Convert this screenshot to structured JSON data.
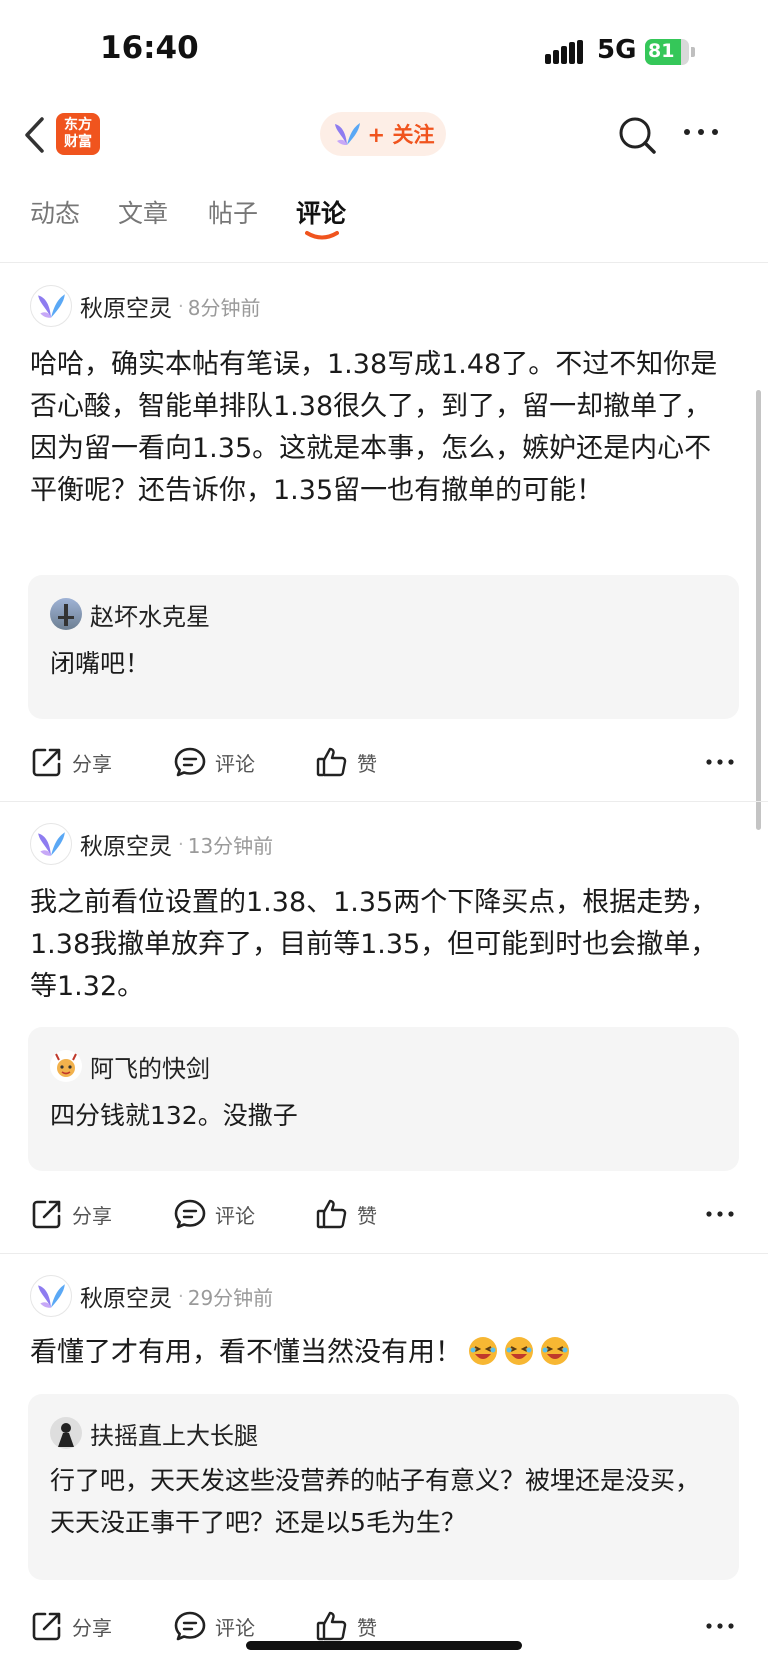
{
  "status_bar": {
    "time": "16:40",
    "network": "5G",
    "battery": "81",
    "battery_level": 0.81
  },
  "nav": {
    "logo_line1": "东方",
    "logo_line2": "财富",
    "follow_label": "+ 关注"
  },
  "tabs": [
    {
      "label": "动态"
    },
    {
      "label": "文章"
    },
    {
      "label": "帖子"
    },
    {
      "label": "评论",
      "active": true
    }
  ],
  "posts": [
    {
      "author": "秋原空灵",
      "time_ago": "8分钟前",
      "content": "哈哈，确实本帖有笔误，1.38写成1.48了。不过不知你是否心酸，智能单排队1.38很久了，到了，留一却撤单了，因为留一看向1.35。这就是本事，怎么，嫉妒还是内心不平衡呢？还告诉你，1.35留一也有撤单的可能！",
      "reply": {
        "name": "赵坏水克星",
        "text": "闭嘴吧！"
      },
      "actions": {
        "share": "分享",
        "comment": "评论",
        "like": "赞"
      }
    },
    {
      "author": "秋原空灵",
      "time_ago": "13分钟前",
      "content": "我之前看位设置的1.38、1.35两个下降买点，根据走势，1.38我撤单放弃了，目前等1.35，但可能到时也会撤单，等1.32。",
      "reply": {
        "name": "阿飞的快剑",
        "text": "四分钱就132。没撒子"
      },
      "actions": {
        "share": "分享",
        "comment": "评论",
        "like": "赞"
      }
    },
    {
      "author": "秋原空灵",
      "time_ago": "29分钟前",
      "content": "看懂了才有用，看不懂当然没有用！",
      "emojis": [
        "laugh-emoji",
        "laugh-emoji",
        "laugh-emoji"
      ],
      "reply": {
        "name": "扶摇直上大长腿",
        "text": "行了吧，天天发这些没营养的帖子有意义？被埋还是没买，天天没正事干了吧？还是以5毛为生？"
      },
      "actions": {
        "share": "分享",
        "comment": "评论",
        "like": "赞"
      }
    }
  ],
  "colors": {
    "brand": "#f0541e",
    "follow_bg": "#fdeee6",
    "reply_bg": "#f5f5f5",
    "battery": "#35c759"
  }
}
